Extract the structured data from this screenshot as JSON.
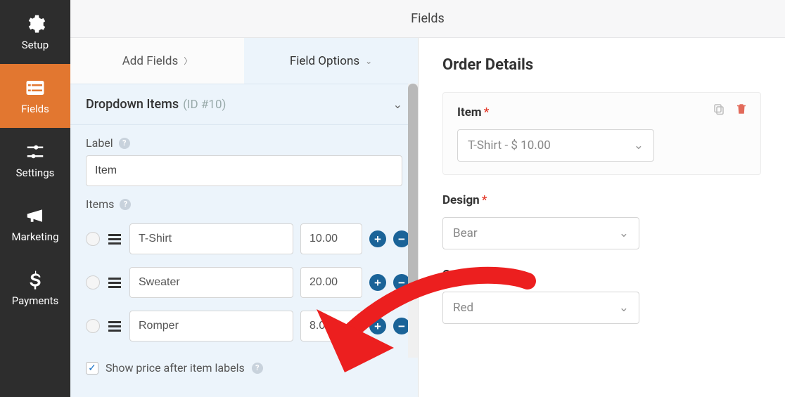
{
  "header": {
    "title": "Fields"
  },
  "sidebar": {
    "items": [
      {
        "label": "Setup"
      },
      {
        "label": "Fields"
      },
      {
        "label": "Settings"
      },
      {
        "label": "Marketing"
      },
      {
        "label": "Payments"
      }
    ]
  },
  "tabs": {
    "add": "Add Fields",
    "options": "Field Options"
  },
  "section": {
    "title": "Dropdown Items",
    "id": "(ID #10)"
  },
  "labelField": {
    "caption": "Label",
    "value": "Item"
  },
  "itemsField": {
    "caption": "Items",
    "rows": [
      {
        "name": "T-Shirt",
        "price": "10.00"
      },
      {
        "name": "Sweater",
        "price": "20.00"
      },
      {
        "name": "Romper",
        "price": "8.00"
      }
    ]
  },
  "showPrice": {
    "label": "Show price after item labels",
    "checked": true
  },
  "preview": {
    "title": "Order Details",
    "fields": [
      {
        "label": "Item",
        "value": "T-Shirt - $ 10.00"
      },
      {
        "label": "Design",
        "value": "Bear"
      },
      {
        "label": "Color",
        "value": "Red"
      }
    ]
  }
}
